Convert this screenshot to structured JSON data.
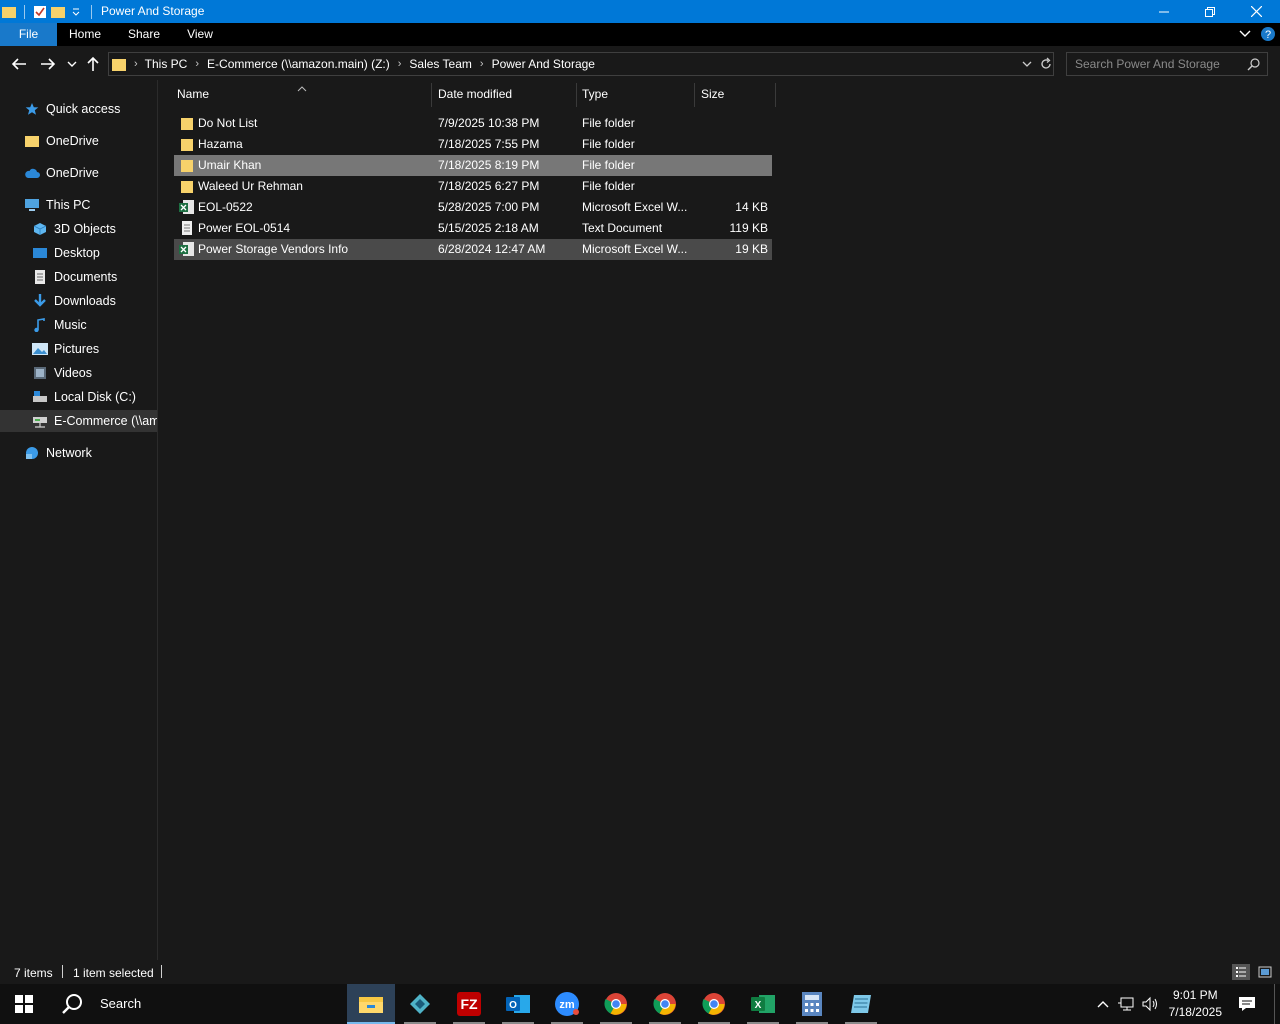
{
  "window": {
    "title": "Power And Storage",
    "accent": "#0078d7"
  },
  "ribbon": {
    "tabs": [
      {
        "label": "File"
      },
      {
        "label": "Home"
      },
      {
        "label": "Share"
      },
      {
        "label": "View"
      }
    ]
  },
  "address": {
    "crumbs": [
      "This PC",
      "E-Commerce (\\\\amazon.main) (Z:)",
      "Sales Team",
      "Power And Storage"
    ]
  },
  "search": {
    "placeholder": "Search Power And Storage"
  },
  "navpane": {
    "items": [
      {
        "label": "Quick access",
        "icon": "star-icon"
      },
      {
        "label": "OneDrive",
        "icon": "folder-icon"
      },
      {
        "label": "OneDrive",
        "icon": "cloud-icon"
      },
      {
        "label": "This PC",
        "icon": "computer-icon"
      },
      {
        "label": "3D Objects",
        "icon": "cube-icon"
      },
      {
        "label": "Desktop",
        "icon": "desktop-icon"
      },
      {
        "label": "Documents",
        "icon": "document-icon"
      },
      {
        "label": "Downloads",
        "icon": "download-icon"
      },
      {
        "label": "Music",
        "icon": "music-icon"
      },
      {
        "label": "Pictures",
        "icon": "pictures-icon"
      },
      {
        "label": "Videos",
        "icon": "videos-icon"
      },
      {
        "label": "Local Disk (C:)",
        "icon": "disk-icon"
      },
      {
        "label": "E-Commerce (\\\\amazon.main) (Z:)",
        "icon": "network-drive-icon"
      },
      {
        "label": "Network",
        "icon": "network-icon"
      }
    ]
  },
  "columns": {
    "name": "Name",
    "date": "Date modified",
    "type": "Type",
    "size": "Size"
  },
  "files": [
    {
      "name": "Do Not List",
      "date": "7/9/2025 10:38 PM",
      "type": "File folder",
      "size": "",
      "icon": "folder-icon"
    },
    {
      "name": "Hazama",
      "date": "7/18/2025 7:55 PM",
      "type": "File folder",
      "size": "",
      "icon": "folder-icon"
    },
    {
      "name": "Umair Khan",
      "date": "7/18/2025 8:19 PM",
      "type": "File folder",
      "size": "",
      "icon": "folder-icon"
    },
    {
      "name": "Waleed Ur Rehman",
      "date": "7/18/2025 6:27 PM",
      "type": "File folder",
      "size": "",
      "icon": "folder-icon"
    },
    {
      "name": "EOL-0522",
      "date": "5/28/2025 7:00 PM",
      "type": "Microsoft Excel W...",
      "size": "14 KB",
      "icon": "excel-file-icon"
    },
    {
      "name": "Power EOL-0514",
      "date": "5/15/2025 2:18 AM",
      "type": "Text Document",
      "size": "119 KB",
      "icon": "text-file-icon"
    },
    {
      "name": "Power Storage Vendors Info",
      "date": "6/28/2024 12:47 AM",
      "type": "Microsoft Excel W...",
      "size": "19 KB",
      "icon": "excel-file-icon"
    }
  ],
  "status": {
    "items": "7 items",
    "selected": "1 item selected"
  },
  "taskbar": {
    "search_label": "Search",
    "time": "9:01 PM",
    "date": "7/18/2025"
  }
}
